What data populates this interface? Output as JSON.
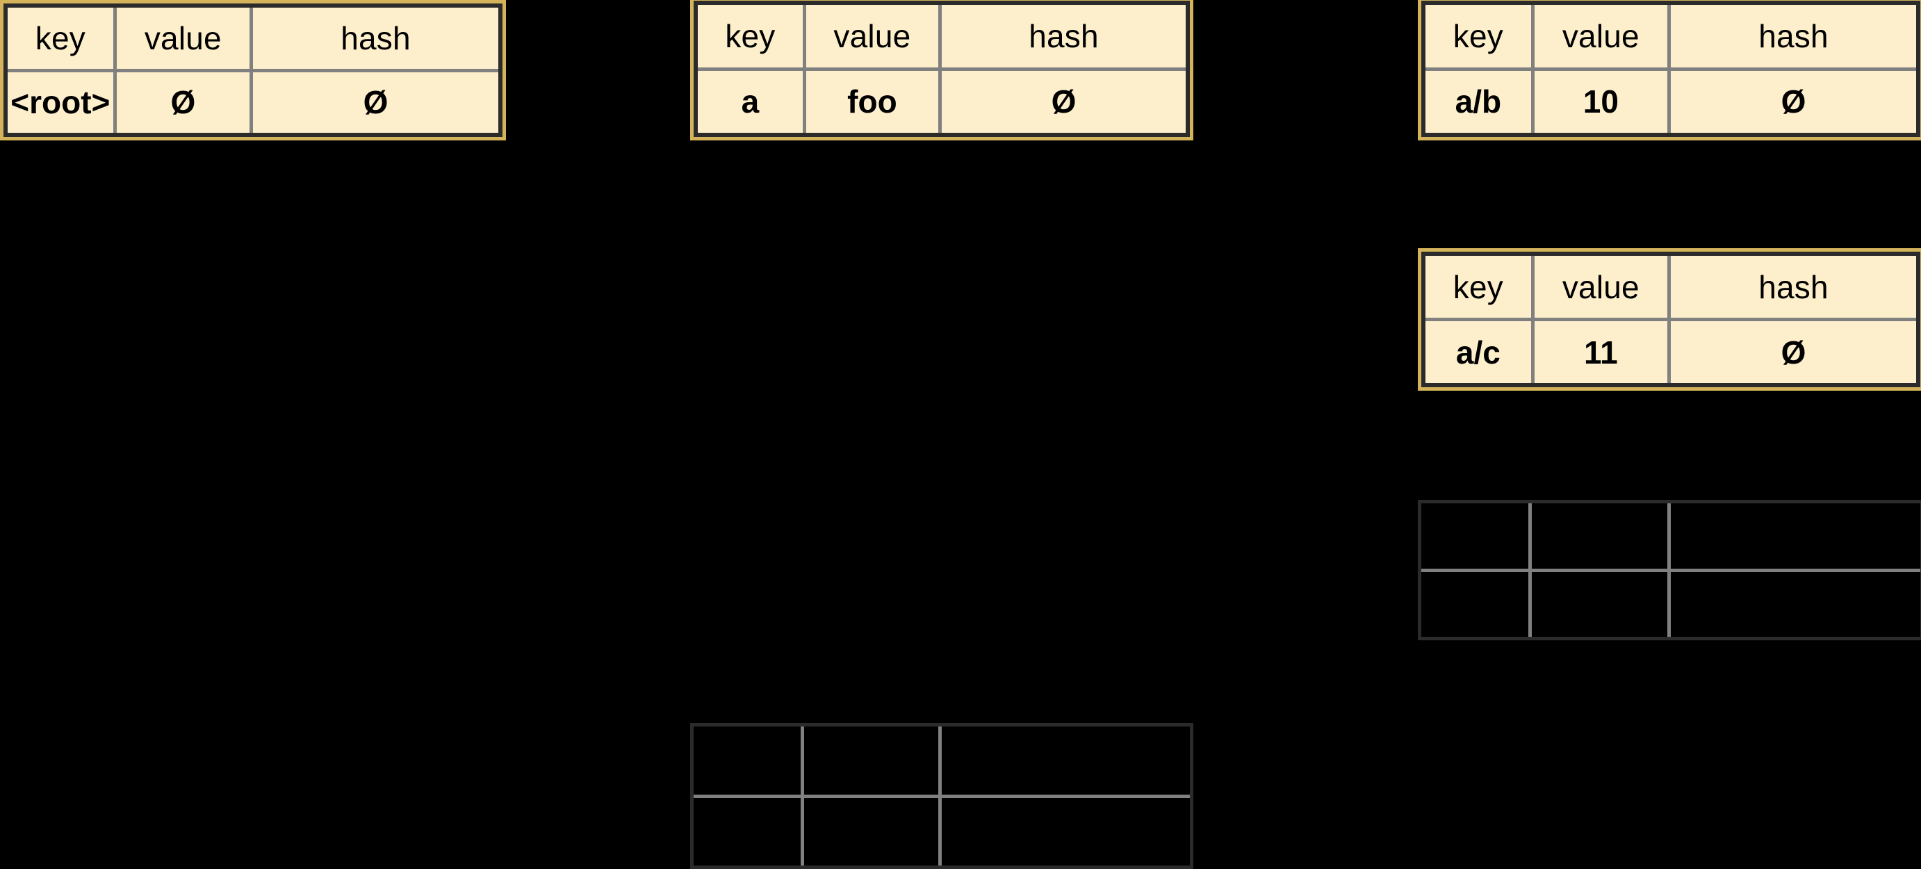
{
  "diagram": {
    "title": "Key-Value-Hash Node Tables",
    "background_color": "#000000",
    "colors": {
      "table_fill": "#FDEFCB",
      "outer_border": "#D4B35A",
      "inner_border": "#2B2B2B",
      "gridline": "#808080",
      "text": "#000000",
      "ghost_border": "#2B2B2B"
    },
    "columns": [
      "key",
      "value",
      "hash"
    ],
    "empty_symbol": "Ø"
  },
  "nodes": [
    {
      "id": "root",
      "name": "root-node-table",
      "headers": {
        "key": "key",
        "value": "value",
        "hash": "hash"
      },
      "row": {
        "key": "<root>",
        "value": "Ø",
        "hash": "Ø"
      }
    },
    {
      "id": "a",
      "name": "node-a-table",
      "headers": {
        "key": "key",
        "value": "value",
        "hash": "hash"
      },
      "row": {
        "key": "a",
        "value": "foo",
        "hash": "Ø"
      }
    },
    {
      "id": "ab",
      "name": "node-a-b-table",
      "headers": {
        "key": "key",
        "value": "value",
        "hash": "hash"
      },
      "row": {
        "key": "a/b",
        "value": "10",
        "hash": "Ø"
      }
    },
    {
      "id": "ac",
      "name": "node-a-c-table",
      "headers": {
        "key": "key",
        "value": "value",
        "hash": "hash"
      },
      "row": {
        "key": "a/c",
        "value": "11",
        "hash": "Ø"
      }
    },
    {
      "id": "ghost-right",
      "name": "empty-node-table-right",
      "headers": {
        "key": "",
        "value": "",
        "hash": ""
      },
      "row": {
        "key": "",
        "value": "",
        "hash": ""
      }
    },
    {
      "id": "ghost-center",
      "name": "empty-node-table-center",
      "headers": {
        "key": "",
        "value": "",
        "hash": ""
      },
      "row": {
        "key": "",
        "value": "",
        "hash": ""
      }
    }
  ]
}
